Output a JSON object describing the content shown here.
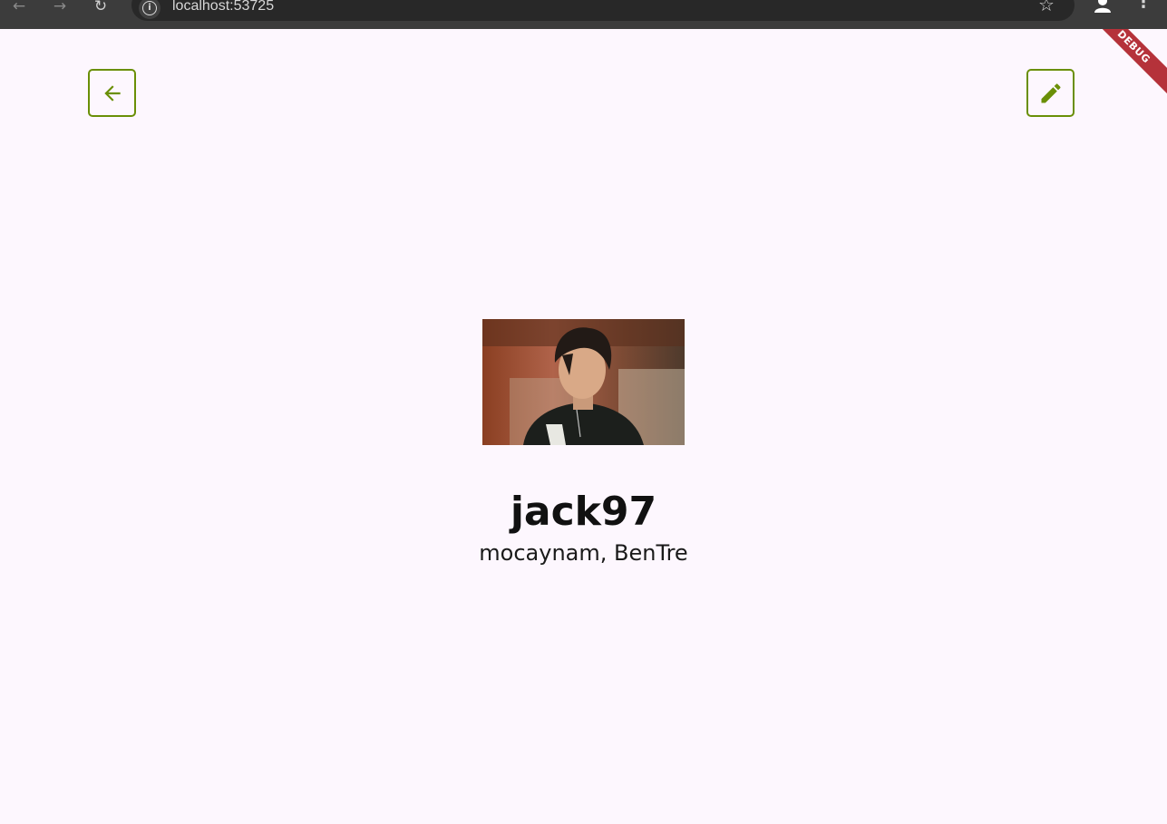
{
  "browser": {
    "url": "localhost:53725",
    "back_icon": "arrow-left-icon",
    "forward_icon": "arrow-right-icon",
    "reload_icon": "reload-icon",
    "star_icon": "star-icon",
    "profile_icon": "profile-icon",
    "menu_icon": "kebab-menu-icon"
  },
  "app": {
    "debug_banner": "DEBUG",
    "back_button_icon": "arrow-left-icon",
    "edit_button_icon": "pencil-icon",
    "accent_color": "#6a8f07",
    "background_color": "#fdf7fe",
    "profile": {
      "username": "jack97",
      "location": "mocaynam, BenTre"
    }
  }
}
